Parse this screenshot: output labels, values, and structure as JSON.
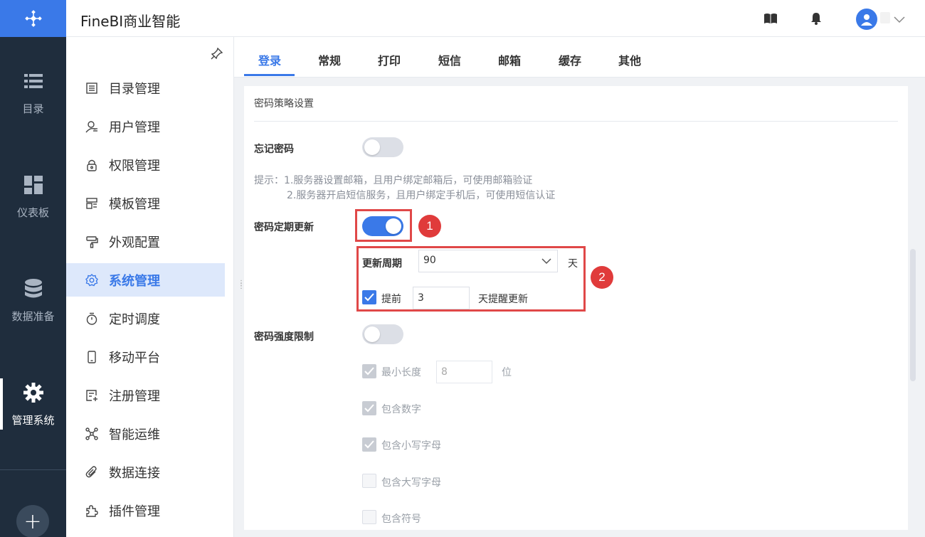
{
  "app": {
    "title": "FineBI商业智能"
  },
  "rail": {
    "items": [
      {
        "label": "目录",
        "icon": "list-icon"
      },
      {
        "label": "仪表板",
        "icon": "dashboard-icon"
      },
      {
        "label": "数据准备",
        "icon": "database-icon"
      },
      {
        "label": "管理系统",
        "icon": "gear-icon",
        "active": true
      }
    ],
    "add_label": "+"
  },
  "subnav": {
    "items": [
      {
        "label": "目录管理",
        "icon": "directory-icon"
      },
      {
        "label": "用户管理",
        "icon": "user-icon"
      },
      {
        "label": "权限管理",
        "icon": "lock-icon"
      },
      {
        "label": "模板管理",
        "icon": "template-icon"
      },
      {
        "label": "外观配置",
        "icon": "paint-icon"
      },
      {
        "label": "系统管理",
        "icon": "gear-icon",
        "active": true
      },
      {
        "label": "定时调度",
        "icon": "timer-icon"
      },
      {
        "label": "移动平台",
        "icon": "mobile-icon"
      },
      {
        "label": "注册管理",
        "icon": "register-icon"
      },
      {
        "label": "智能运维",
        "icon": "network-icon"
      },
      {
        "label": "数据连接",
        "icon": "paperclip-icon"
      },
      {
        "label": "插件管理",
        "icon": "puzzle-icon"
      }
    ]
  },
  "tabs": [
    {
      "label": "登录",
      "active": true
    },
    {
      "label": "常规"
    },
    {
      "label": "打印"
    },
    {
      "label": "短信"
    },
    {
      "label": "邮箱"
    },
    {
      "label": "缓存"
    },
    {
      "label": "其他"
    }
  ],
  "settings": {
    "section_title": "密码策略设置",
    "forgot_password": {
      "label": "忘记密码",
      "enabled": false
    },
    "hint_line1": "提示：1.服务器设置邮箱，且用户绑定邮箱后，可使用邮箱验证",
    "hint_line2": "2.服务器开启短信服务，且用户绑定手机后，可使用短信认证",
    "periodic_update": {
      "label": "密码定期更新",
      "enabled": true,
      "cycle_label": "更新周期",
      "cycle_value": "90",
      "cycle_unit": "天",
      "advance_checked": true,
      "advance_label": "提前",
      "advance_value": "3",
      "advance_suffix": "天提醒更新"
    },
    "strength": {
      "label": "密码强度限制",
      "enabled": false,
      "min_length_label": "最小长度",
      "min_length_value": "8",
      "min_length_unit": "位",
      "include_digits": "包含数字",
      "include_lower": "包含小写字母",
      "include_upper": "包含大写字母",
      "include_symbol": "包含符号"
    }
  },
  "annotations": {
    "badge1": "1",
    "badge2": "2"
  },
  "colors": {
    "accent": "#3a79e8",
    "rail_bg": "#1f2d3d",
    "annotation_red": "#e04848"
  }
}
